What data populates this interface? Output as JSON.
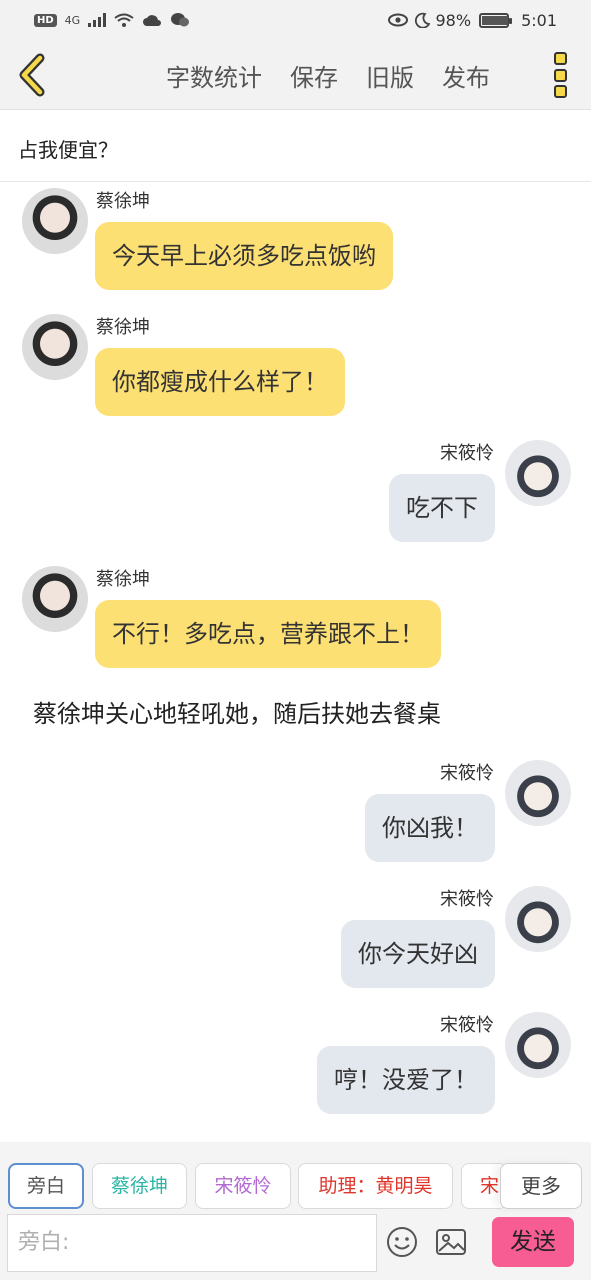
{
  "status_bar": {
    "network": "4G",
    "battery_text": "98%",
    "battery_level": 0.98,
    "time": "5:01"
  },
  "header": {
    "actions": [
      "字数统计",
      "保存",
      "旧版",
      "发布"
    ]
  },
  "title": "占我便宜？",
  "messages": [
    {
      "side": "left",
      "name": "蔡徐坤",
      "text": "今天早上必须多吃点饭哟"
    },
    {
      "side": "left",
      "name": "蔡徐坤",
      "text": "你都瘦成什么样了！"
    },
    {
      "side": "right",
      "name": "宋筱怜",
      "text": "吃不下"
    },
    {
      "side": "left",
      "name": "蔡徐坤",
      "text": "不行！多吃点，营养跟不上！"
    },
    {
      "side": "narration",
      "text": "蔡徐坤关心地轻吼她，随后扶她去餐桌"
    },
    {
      "side": "right",
      "name": "宋筱怜",
      "text": "你凶我！"
    },
    {
      "side": "right",
      "name": "宋筱怜",
      "text": "你今天好凶"
    },
    {
      "side": "right",
      "name": "宋筱怜",
      "text": "哼！没爱了！"
    }
  ],
  "role_chips": [
    {
      "label": "旁白",
      "color": "#555555",
      "selected": true
    },
    {
      "label": "蔡徐坤",
      "color": "#2bb5a5"
    },
    {
      "label": "宋筱怜",
      "color": "#b36ad0"
    },
    {
      "label": "助理：黄明昊",
      "color": "#e0352b"
    },
    {
      "label": "宋",
      "color": "#e0352b"
    }
  ],
  "more_label": "更多",
  "input": {
    "placeholder": "旁白:"
  },
  "send_label": "发送",
  "colors": {
    "left_bubble": "#fde074",
    "right_bubble": "#e3e7ee",
    "send_button": "#f75c93",
    "accent_yellow": "#f5d94a"
  }
}
